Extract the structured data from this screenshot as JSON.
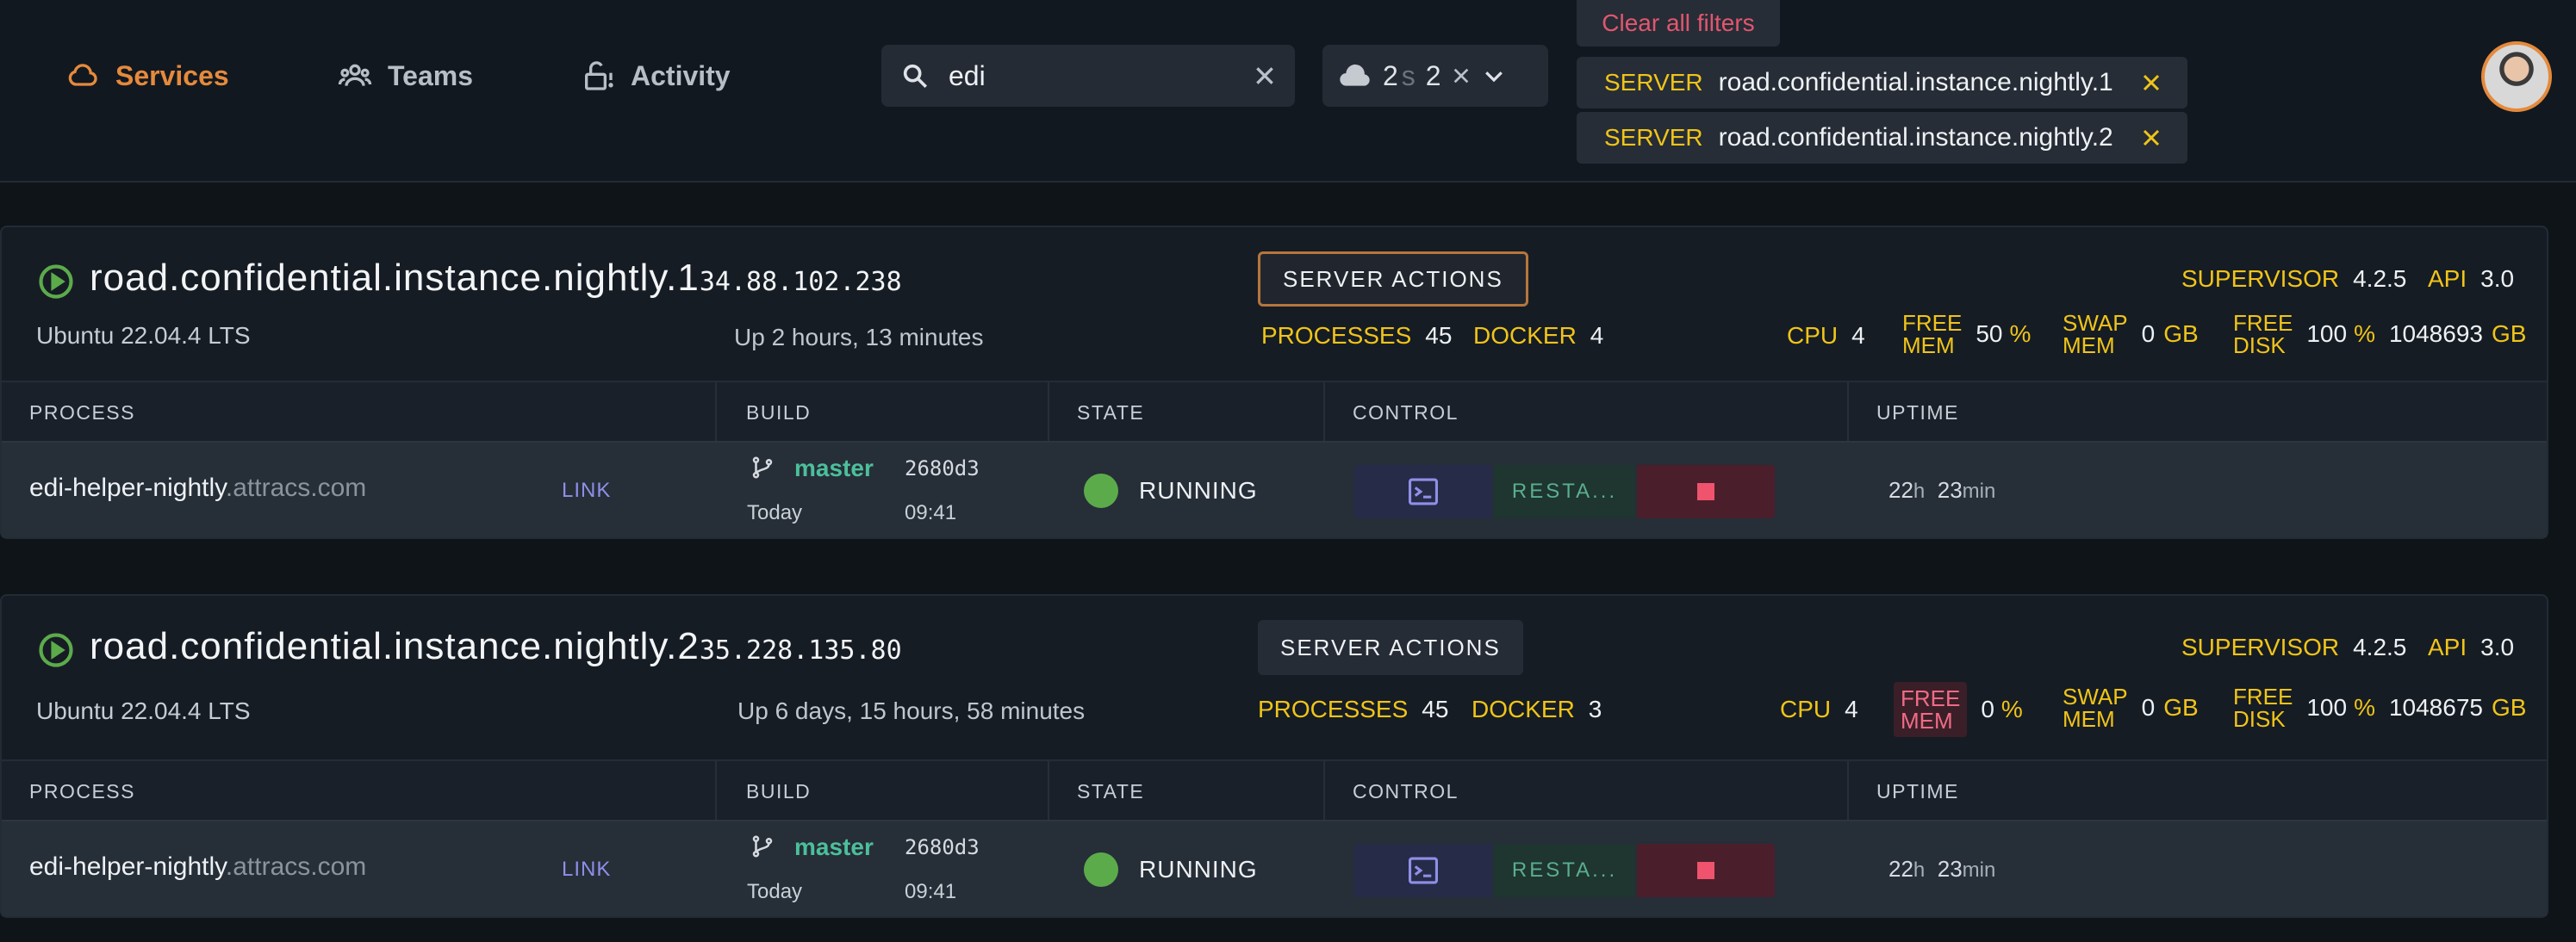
{
  "nav": {
    "items": [
      {
        "label": "Services",
        "icon": "cloud-icon",
        "active": true
      },
      {
        "label": "Teams",
        "icon": "users-icon",
        "active": false
      },
      {
        "label": "Activity",
        "icon": "lock-icon",
        "active": false
      }
    ]
  },
  "search": {
    "value": "edi",
    "placeholder": ""
  },
  "env_filter": {
    "count_a": "2",
    "count_a_suffix": "s",
    "count_b": "2"
  },
  "filters": {
    "clear_all": "Clear all filters",
    "chips": [
      {
        "key": "SERVER",
        "value": "road.confidential.instance.nightly.1"
      },
      {
        "key": "SERVER",
        "value": "road.confidential.instance.nightly.2"
      }
    ]
  },
  "table_headers": {
    "process": "PROCESS",
    "build": "BUILD",
    "state": "STATE",
    "control": "CONTROL",
    "uptime": "UPTIME"
  },
  "servers": [
    {
      "name": "road.confidential.instance.nightly.1",
      "ip": "34.88.102.238",
      "os": "Ubuntu 22.04.4 LTS",
      "uptime": "Up 2 hours, 13 minutes",
      "actions_label": "SERVER ACTIONS",
      "supervisor_label": "SUPERVISOR",
      "supervisor": "4.2.5",
      "api_label": "API",
      "api": "3.0",
      "processes_label": "PROCESSES",
      "processes": "45",
      "docker_label": "DOCKER",
      "docker": "4",
      "cpu_label": "CPU",
      "cpu": "4",
      "free_mem_label_1": "FREE",
      "free_mem_label_2": "MEM",
      "free_mem": "50",
      "free_mem_unit": "%",
      "swap_label_1": "SWAP",
      "swap_label_2": "MEM",
      "swap": "0",
      "swap_unit": "GB",
      "disk_label_1": "FREE",
      "disk_label_2": "DISK",
      "disk_pct": "100",
      "disk_pct_unit": "%",
      "disk_gb": "1048693",
      "disk_unit": "GB",
      "rows": [
        {
          "process": "edi-helper-nightly",
          "domain": ".attracs.com",
          "link": "LINK",
          "branch": "master",
          "commit": "2680d3",
          "day": "Today",
          "time": "09:41",
          "state": "RUNNING",
          "restart": "RESTA...",
          "up_h": "22",
          "up_h_unit": "h",
          "up_m": "23",
          "up_m_unit": "min"
        }
      ]
    },
    {
      "name": "road.confidential.instance.nightly.2",
      "ip": "35.228.135.80",
      "os": "Ubuntu 22.04.4 LTS",
      "uptime": "Up 6 days, 15 hours, 58 minutes",
      "actions_label": "SERVER ACTIONS",
      "supervisor_label": "SUPERVISOR",
      "supervisor": "4.2.5",
      "api_label": "API",
      "api": "3.0",
      "processes_label": "PROCESSES",
      "processes": "45",
      "docker_label": "DOCKER",
      "docker": "3",
      "cpu_label": "CPU",
      "cpu": "4",
      "free_mem_label_1": "FREE",
      "free_mem_label_2": "MEM",
      "free_mem": "0",
      "free_mem_unit": "%",
      "swap_label_1": "SWAP",
      "swap_label_2": "MEM",
      "swap": "0",
      "swap_unit": "GB",
      "disk_label_1": "FREE",
      "disk_label_2": "DISK",
      "disk_pct": "100",
      "disk_pct_unit": "%",
      "disk_gb": "1048675",
      "disk_unit": "GB",
      "rows": [
        {
          "process": "edi-helper-nightly",
          "domain": ".attracs.com",
          "link": "LINK",
          "branch": "master",
          "commit": "2680d3",
          "day": "Today",
          "time": "09:41",
          "state": "RUNNING",
          "restart": "RESTA...",
          "up_h": "22",
          "up_h_unit": "h",
          "up_m": "23",
          "up_m_unit": "min"
        }
      ]
    }
  ],
  "colors": {
    "accent": "#e58a3c",
    "running": "#5cab4b",
    "label_yellow": "#f0c419",
    "danger": "#f0536e"
  }
}
